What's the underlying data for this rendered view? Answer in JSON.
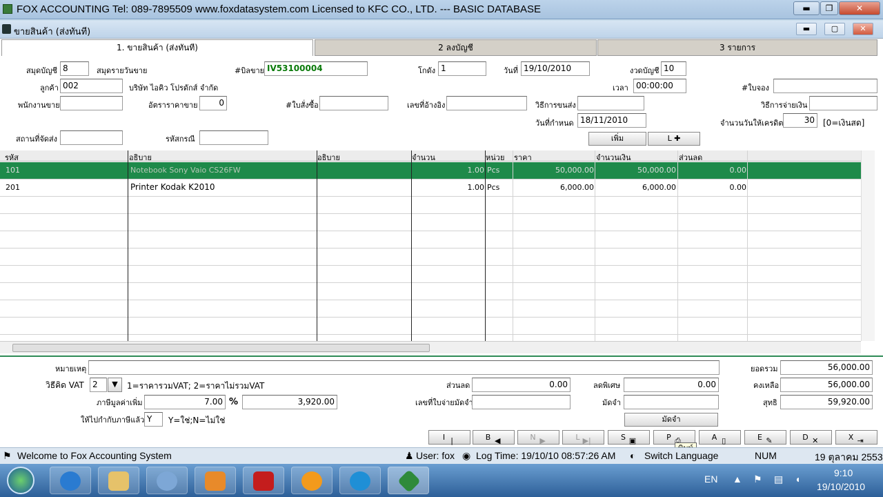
{
  "app": {
    "title": "FOX ACCOUNTING   Tel: 089-7895509   www.foxdatasystem.com    Licensed to KFC CO., LTD. --- BASIC DATABASE",
    "window_minimize": "▬",
    "window_restore": "❐",
    "window_close": "✕"
  },
  "inner_window": {
    "title": "ขายสินค้า (ส่งทันที)",
    "minimize": "▬",
    "restore": "▢",
    "close": "✕"
  },
  "tabs": [
    {
      "label": "1.  ขายสินค้า (ส่งทันที)",
      "active": true
    },
    {
      "label": "2   ลงบัญชี",
      "active": false
    },
    {
      "label": "3   รายการ",
      "active": false
    }
  ],
  "form": {
    "journal_label": "สมุดบัญชี",
    "journal_value": "8",
    "journal_name": "สมุดรายวันขาย",
    "invoice_label": "#บิลขาย",
    "invoice_value": "IV53100004",
    "warehouse_label": "โกดัง",
    "warehouse_value": "1",
    "date_label": "วันที่",
    "date_value": "19/10/2010",
    "period_label": "งวดบัญชี",
    "period_value": "10",
    "customer_label": "ลูกค้า",
    "customer_value": "002",
    "customer_name": "บริษัท ไอคิว โปรดักส์ จำกัด",
    "time_label": "เวลา",
    "time_value": "00:00:00",
    "booking_label": "#ใบจอง",
    "booking_value": "",
    "salesperson_label": "พนักงานขาย",
    "salesperson_value": "",
    "price_rate_label": "อัตราราคาขาย",
    "price_rate_value": "0",
    "po_label": "#ใบสั่งซื้อ",
    "po_value": "",
    "ref_label": "เลขที่อ้างอิง",
    "ref_value": "",
    "delivery_method_label": "วิธีการขนส่ง",
    "delivery_method_value": "",
    "payment_method_label": "วิธีการจ่ายเงิน",
    "payment_method_value": "",
    "due_date_label": "วันที่กำหนด",
    "due_date_value": "18/11/2010",
    "credit_days_label": "จำนวนวันให้เครดิต",
    "credit_days_value": "30",
    "credit_note": "[0=เงินสด]",
    "ship_to_label": "สถานที่จัดส่ง",
    "ship_to_value": "",
    "zip_label": "รหัสกรณี",
    "zip_value": "",
    "add_button": "เพิ่ม",
    "lookup_button": "L ✚"
  },
  "grid": {
    "columns": [
      "รหัส",
      "อธิบาย",
      "อธิบาย",
      "จำนวน",
      "หน่วย",
      "ราคา",
      "จำนวนเงิน",
      "ส่วนลด"
    ],
    "rows": [
      {
        "code": "101",
        "desc": "Notebook Sony Vaio CS26FW",
        "desc2": "",
        "qty": "1.00",
        "unit": "Pcs",
        "price": "50,000.00",
        "amount": "50,000.00",
        "discount": "0.00",
        "selected": true
      },
      {
        "code": "201",
        "desc": "Printer Kodak K2010",
        "desc2": "",
        "qty": "1.00",
        "unit": "Pcs",
        "price": "6,000.00",
        "amount": "6,000.00",
        "discount": "0.00",
        "selected": false
      }
    ]
  },
  "footer": {
    "note_label": "หมายเหตุ",
    "note_value": "",
    "vat_method_label": "วิธีคิด VAT",
    "vat_method_value": "2",
    "vat_method_hint": "1=ราคารวมVAT; 2=ราคาไม่รวมVAT",
    "vat_label": "ภาษีมูลค่าเพิ่ม",
    "vat_rate": "7.00",
    "percent_sign": "%",
    "vat_amount": "3,920.00",
    "vat_included_label": "ให้ไปกำกับภาษีแล้ว",
    "vat_included_value": "Y",
    "vat_included_hint": "Y=ใช่;N=ไม่ใช่",
    "discount_label": "ส่วนลด",
    "discount_value": "0.00",
    "deposit_ref_label": "เลขที่ใบจ่ายมัดจำ",
    "deposit_ref_value": "",
    "special_discount_label": "ลดพิเศษ",
    "special_discount_value": "0.00",
    "deposit_label": "มัดจำ",
    "deposit_value": "",
    "deposit_button": "มัดจำ",
    "total_label": "ยอดรวม",
    "total_value": "56,000.00",
    "remaining_label": "คงเหลือ",
    "remaining_value": "56,000.00",
    "net_label": "สุทธิ",
    "net_value": "59,920.00"
  },
  "nav": [
    {
      "label": "I",
      "icon": "first-record-icon"
    },
    {
      "label": "B",
      "icon": "previous-record-icon"
    },
    {
      "label": "N",
      "icon": "next-record-icon"
    },
    {
      "label": "L",
      "icon": "last-record-icon"
    },
    {
      "label": "S",
      "icon": "save-icon"
    },
    {
      "label": "P",
      "icon": "print-icon"
    },
    {
      "label": "A",
      "icon": "add-document-icon"
    },
    {
      "label": "E",
      "icon": "edit-icon"
    },
    {
      "label": "D",
      "icon": "delete-icon"
    },
    {
      "label": "X",
      "icon": "exit-icon"
    }
  ],
  "tooltip": "พิมพ์",
  "status": {
    "welcome": "Welcome to Fox Accounting System",
    "user": "User: fox",
    "log_time": "Log Time: 19/10/10 08:57:26 AM",
    "switch_language": "Switch Language",
    "num": "NUM",
    "thai_date": "19 ตุลาคม 2553"
  },
  "taskbar": {
    "lang": "EN",
    "time": "9:10",
    "date": "19/10/2010"
  },
  "colors": {
    "selected_row": "#1e8a4a",
    "accent_green": "#2d8a55",
    "invoice_green": "#0a7a0a"
  }
}
